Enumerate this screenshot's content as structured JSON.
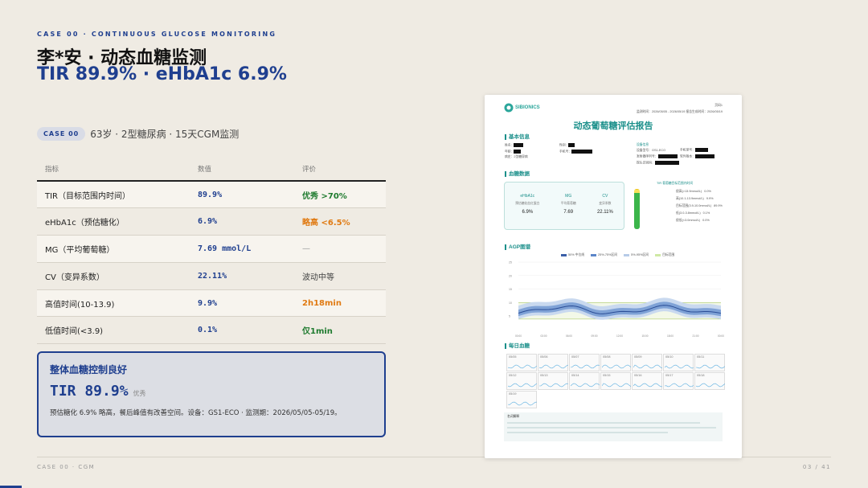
{
  "eyebrow": "CASE 00 · CONTINUOUS GLUCOSE MONITORING",
  "title_line1": "李*安 · 动态血糖监测",
  "title_line2": "TIR 89.9% · eHbA1c 6.9%",
  "case_pill": "CASE 00",
  "patient_summary": "63岁 · 2型糖尿病 · 15天CGM监测",
  "table": {
    "headers": [
      "指标",
      "数值",
      "评价"
    ],
    "rows": [
      {
        "metric": "TIR（目标范围内时间）",
        "value": "89.9%",
        "eval": "优秀 >70%",
        "eval_style": "good"
      },
      {
        "metric": "eHbA1c（预估糖化）",
        "value": "6.9%",
        "eval": "略高 <6.5%",
        "eval_style": "warn"
      },
      {
        "metric": "MG（平均葡萄糖）",
        "value": "7.69 mmol/L",
        "eval": "—",
        "eval_style": "neutral"
      },
      {
        "metric": "CV（变异系数）",
        "value": "22.11%",
        "eval": "波动中等",
        "eval_style": "plain"
      },
      {
        "metric": "高值时间(10-13.9)",
        "value": "9.9%",
        "eval": "2h18min",
        "eval_style": "warn"
      },
      {
        "metric": "低值时间(<3.9)",
        "value": "0.1%",
        "eval": "仅1min",
        "eval_style": "good"
      }
    ]
  },
  "callout": {
    "title": "整体血糖控制良好",
    "metric": "TIR 89.9%",
    "tag": "优秀",
    "desc": "预估糖化 6.9% 略高，餐后峰值有改善空间。设备：GS1-ECO · 监测期：2026/05/05-05/19。"
  },
  "footer_left": "CASE 00 · CGM",
  "footer_right": "03 / 41",
  "colors": {
    "accent": "#1f3f8f",
    "good": "#1e7a2e",
    "warn": "#e07a12",
    "report_teal": "#1a8f8a"
  },
  "report": {
    "brand": "SIBIONICS",
    "page_no": "页码1",
    "header_meta": "监测时间：2026/05/05 - 2026/05/19  报告生成时间：2026/05/19",
    "title": "动态葡萄糖评估报告",
    "section_basic": "基本信息",
    "basic": {
      "name_label": "姓名：",
      "gender_label": "性别：",
      "age_label": "年龄：",
      "phone_label": "手机号：",
      "condition_label": "病史：",
      "condition_value": "2型糖尿病",
      "device_header": "设备信息",
      "device_model_label": "设备型号：",
      "device_model_value": "GS1-ECO",
      "device_sn_label": "发射器序列号：",
      "device_phone_label": "手机型号：",
      "software_label": "软件版本：",
      "probe_label": "探头识别码："
    },
    "section_glucose": "血糖数据",
    "stats": [
      {
        "label": "eHbA1c",
        "sub": "预估糖化血红蛋白",
        "value": "6.9%"
      },
      {
        "label": "MG",
        "sub": "平均葡萄糖",
        "value": "7.69"
      },
      {
        "label": "CV",
        "sub": "变异系数",
        "value": "22.11%"
      }
    ],
    "tir_caption": "TIR",
    "tir_title": "葡萄糖目标范围内时间",
    "tir_bar": [
      {
        "label": "很高",
        "fraction": 0.01,
        "color": "#f0c419"
      },
      {
        "label": "高",
        "fraction": 0.099,
        "color": "#f7e15a"
      },
      {
        "label": "目标范围",
        "fraction": 0.899,
        "color": "#3bb54a"
      },
      {
        "label": "低",
        "fraction": 0.001,
        "color": "#e53935"
      }
    ],
    "tir_lines": [
      "很高(>13.9mmol/L)",
      "高(10.1-13.9mmol/L)",
      "目标范围(3.9-10.0mmol/L)",
      "低(3.0-3.8mmol/L)",
      "很低(<3.0mmol/L)"
    ],
    "tir_pct": [
      "0.0%",
      "9.9%",
      "89.9%",
      "0.1%",
      "0.0%"
    ],
    "section_agp": "AGP图谱",
    "agp_legend": [
      "50% 中位线",
      "25%-75%区间",
      "5%-95%区间",
      "目标范围"
    ],
    "agp_y_ticks": [
      "25",
      "20",
      "15",
      "10",
      "5"
    ],
    "agp_x_ticks": [
      "00:00",
      "03:00",
      "06:00",
      "09:00",
      "12:00",
      "15:00",
      "18:00",
      "21:00",
      "00:00"
    ],
    "section_daily": "每日血糖",
    "days": [
      "05/05",
      "05/06",
      "05/07",
      "05/08",
      "05/09",
      "05/10",
      "05/11",
      "05/12",
      "05/13",
      "05/14",
      "05/15",
      "05/16",
      "05/17",
      "05/18",
      "05/19"
    ],
    "notes_title": "名词解释"
  }
}
